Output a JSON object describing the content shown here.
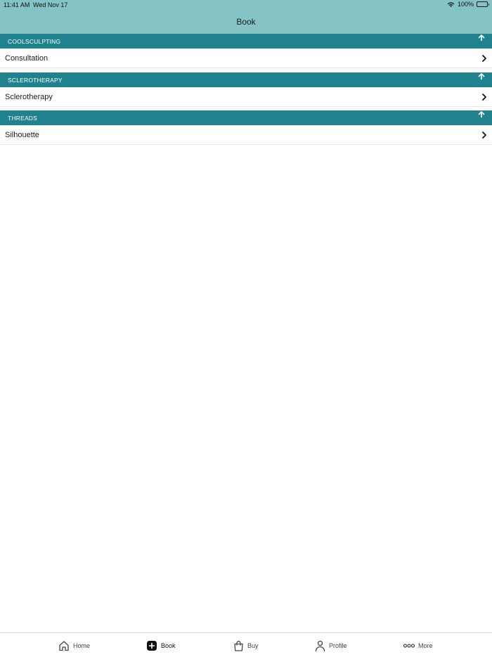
{
  "status_bar": {
    "time": "11:41 AM",
    "date": "Wed Nov 17",
    "battery": "100%"
  },
  "nav": {
    "title": "Book"
  },
  "sections": [
    {
      "header": "COOLSCULPTING",
      "item": "Consultation"
    },
    {
      "header": "SCLEROTHERAPY",
      "item": "Sclerotherapy"
    },
    {
      "header": "THREADS",
      "item": "Silhouette"
    }
  ],
  "tabbar": {
    "home": "Home",
    "book": "Book",
    "buy": "Buy",
    "profile": "Profile",
    "more": "More",
    "active": "book"
  },
  "colors": {
    "topbar": "#84c3c6",
    "section_header": "#21828f",
    "background": "#ffffff"
  }
}
